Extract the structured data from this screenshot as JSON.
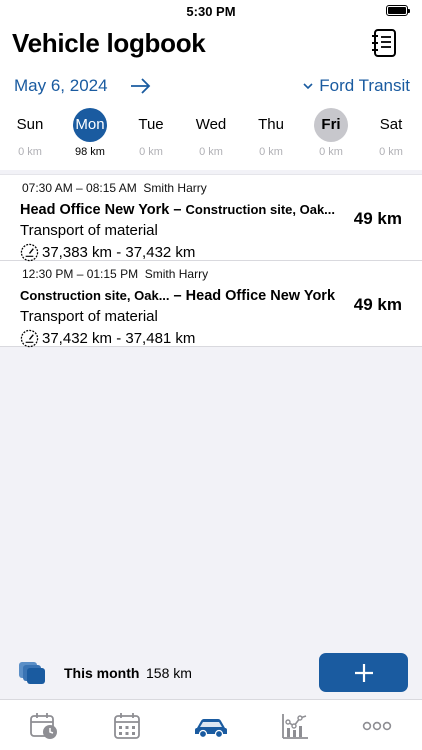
{
  "status_bar": {
    "time": "5:30 PM"
  },
  "header": {
    "title": "Vehicle logbook",
    "logbook_icon": "notebook-icon"
  },
  "date_nav": {
    "date": "May 6, 2024",
    "next_icon": "arrow-right-icon",
    "vehicle": "Ford Transit"
  },
  "week": {
    "days": [
      {
        "name": "Sun",
        "km": "0 km"
      },
      {
        "name": "Mon",
        "km": "98 km",
        "selected": true
      },
      {
        "name": "Tue",
        "km": "0 km"
      },
      {
        "name": "Wed",
        "km": "0 km"
      },
      {
        "name": "Thu",
        "km": "0 km"
      },
      {
        "name": "Fri",
        "km": "0 km",
        "today": true
      },
      {
        "name": "Sat",
        "km": "0 km"
      }
    ]
  },
  "trips": [
    {
      "time": "07:30 AM – 08:15 AM",
      "driver": "Smith Harry",
      "from": "Head Office New York",
      "sep": " – ",
      "to": "Construction site, Oak...",
      "distance": "49 km",
      "purpose": "Transport of material",
      "odometer": "37,383 km - 37,432 km"
    },
    {
      "time": "12:30 PM – 01:15 PM",
      "driver": "Smith Harry",
      "from": "Construction site, Oak...",
      "sep": " – ",
      "to": "Head Office New York",
      "distance": "49 km",
      "purpose": "Transport of material",
      "odometer": "37,432 km - 37,481 km"
    }
  ],
  "summary": {
    "label": "This month",
    "value": "158 km"
  },
  "colors": {
    "accent": "#1a5ba0",
    "background": "#f2f2f7",
    "today_circle": "#c7c7cc"
  },
  "tabs": [
    {
      "icon": "calendar-clock-icon"
    },
    {
      "icon": "calendar-icon"
    },
    {
      "icon": "car-icon",
      "active": true
    },
    {
      "icon": "chart-icon"
    },
    {
      "icon": "more-icon"
    }
  ]
}
